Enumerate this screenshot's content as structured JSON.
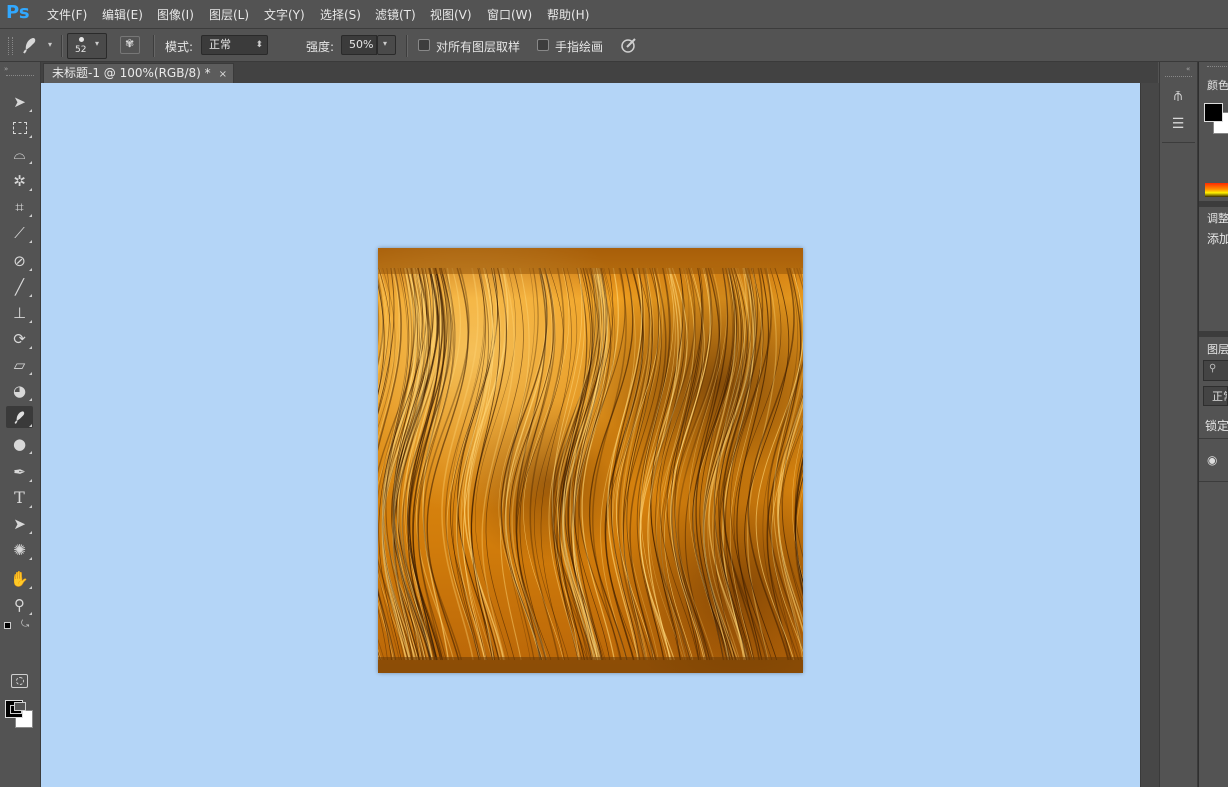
{
  "app": {
    "logo": "Ps"
  },
  "menu": [
    "文件(F)",
    "编辑(E)",
    "图像(I)",
    "图层(L)",
    "文字(Y)",
    "选择(S)",
    "滤镜(T)",
    "视图(V)",
    "窗口(W)",
    "帮助(H)"
  ],
  "options": {
    "tool_icon": "smudge-icon",
    "brush_size": "52",
    "mode_label": "模式:",
    "mode_value": "正常",
    "strength_label": "强度:",
    "strength_value": "50%",
    "sample_all_layers": {
      "label": "对所有图层取样",
      "checked": false
    },
    "finger_painting": {
      "label": "手指绘画",
      "checked": false
    }
  },
  "document": {
    "tab_title": "未标题-1 @ 100%(RGB/8) *",
    "close_glyph": "×"
  },
  "tools": [
    "move-icon",
    "marquee-icon",
    "lasso-icon",
    "magic-wand-icon",
    "crop-icon",
    "eyedropper-icon",
    "healing-brush-icon",
    "brush-icon",
    "clone-stamp-icon",
    "history-brush-icon",
    "eraser-icon",
    "paint-bucket-icon",
    "smudge-icon",
    "dodge-icon",
    "pen-icon",
    "type-icon",
    "path-selection-icon",
    "shape-icon",
    "hand-icon",
    "zoom-icon"
  ],
  "colors": {
    "foreground": "#000000",
    "background": "#ffffff",
    "canvas_bg": "#b4d5f7",
    "ui_bg": "#535353",
    "accent": "#31a8ff"
  },
  "right_panels": {
    "color_title": "颜色",
    "adjust_title": "调整",
    "adjust_add": "添加",
    "layers_title": "图层",
    "layers_mode": "正常",
    "layers_lock": "锁定"
  }
}
